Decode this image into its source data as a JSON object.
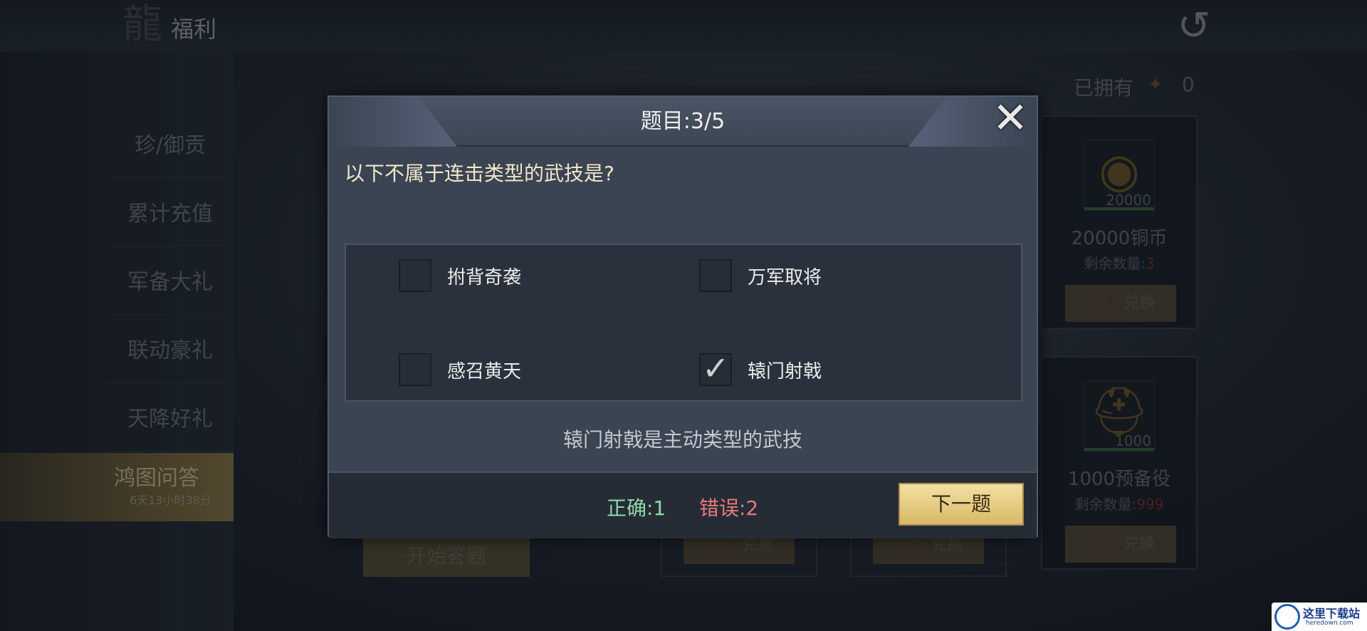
{
  "topbar": {
    "title": "福利",
    "emblem_icon": "dragon-emblem-icon",
    "back_icon": "dragon-back-icon"
  },
  "sidebar": {
    "items": [
      {
        "label": "珍/御贡"
      },
      {
        "label": "累计充值"
      },
      {
        "label": "军备大礼"
      },
      {
        "label": "联动豪礼"
      },
      {
        "label": "天降好礼"
      },
      {
        "label": "鸿图问答",
        "countdown": "6天13小时38分",
        "active": true
      }
    ]
  },
  "owned": {
    "label": "已拥有",
    "icon": "token-icon",
    "count": "0"
  },
  "rewards": [
    {
      "name": "20000铜币",
      "amount": "20000",
      "remaining_label": "剩余数量:",
      "remaining_value": "3",
      "cost": "1",
      "exchange_label": "兑换",
      "icon": "copper-coin-icon"
    },
    {
      "name": "1000预备役",
      "amount": "1000",
      "remaining_label": "剩余数量:",
      "remaining_value": "999",
      "cost": "2",
      "exchange_label": "兑换",
      "icon": "helmet-icon"
    }
  ],
  "lower_exchanges": [
    {
      "cost": "3",
      "label": "兑换"
    },
    {
      "cost": "3",
      "label": "兑换"
    }
  ],
  "start_quiz_label": "开始答题",
  "modal": {
    "counter": "题目:3/5",
    "question": "以下不属于连击类型的武技是?",
    "options": [
      {
        "label": "拊背奇袭",
        "checked": false
      },
      {
        "label": "万军取将",
        "checked": false
      },
      {
        "label": "感召黄天",
        "checked": false
      },
      {
        "label": "辕门射戟",
        "checked": true
      }
    ],
    "explanation": "辕门射戟是主动类型的武技",
    "score_correct": "正确:1",
    "score_wrong": "错误:2",
    "next_label": "下一题",
    "close_icon": "close-icon",
    "colors": {
      "correct": "#8fd9a8",
      "wrong": "#e87a7a",
      "accent": "#d9b868"
    }
  },
  "watermark": {
    "title": "这里下载站",
    "url": "heredown.com"
  }
}
